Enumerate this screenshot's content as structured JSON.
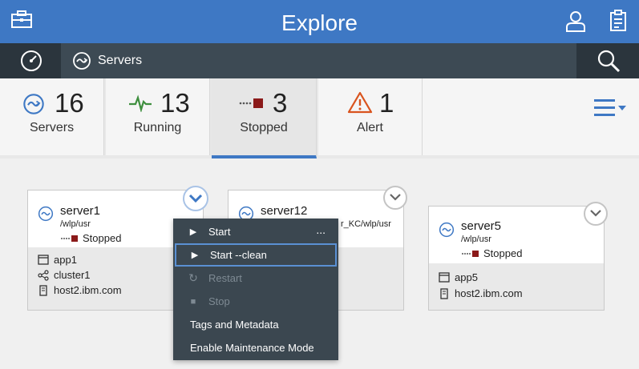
{
  "header": {
    "title": "Explore",
    "left_icon": "toolbox-icon",
    "user_icon": "user-icon",
    "clipboard_icon": "clipboard-icon"
  },
  "nav": {
    "dashboard_icon": "gauge-icon",
    "breadcrumb": "Servers",
    "search_icon": "search-icon"
  },
  "tiles": [
    {
      "count": "16",
      "label": "Servers",
      "icon": "server-icon"
    },
    {
      "count": "13",
      "label": "Running",
      "icon": "pulse-icon"
    },
    {
      "count": "3",
      "label": "Stopped",
      "icon": "stopped-icon"
    },
    {
      "count": "1",
      "label": "Alert",
      "icon": "alert-icon"
    }
  ],
  "filter_icon": "list-menu-icon",
  "cards": [
    {
      "name": "server1",
      "path": "/wlp/usr",
      "status": "Stopped",
      "app": "app1",
      "cluster": "cluster1",
      "host": "host2.ibm.com"
    },
    {
      "name": "server12",
      "path": "r_KC/wlp/usr"
    },
    {
      "name": "server5",
      "path": "/wlp/usr",
      "status": "Stopped",
      "app": "app5",
      "host": "host2.ibm.com"
    }
  ],
  "menu": {
    "more_label": "...",
    "items": [
      {
        "label": "Start"
      },
      {
        "label": "Start --clean"
      },
      {
        "label": "Restart"
      },
      {
        "label": "Stop"
      },
      {
        "label": "Tags and Metadata"
      },
      {
        "label": "Enable Maintenance Mode"
      }
    ]
  },
  "colors": {
    "header_blue": "#3e78c4",
    "nav_dark": "#3d4a54",
    "stopped_red": "#8b1a1a",
    "alert_orange": "#d9541e",
    "running_green": "#3e8f3e"
  }
}
